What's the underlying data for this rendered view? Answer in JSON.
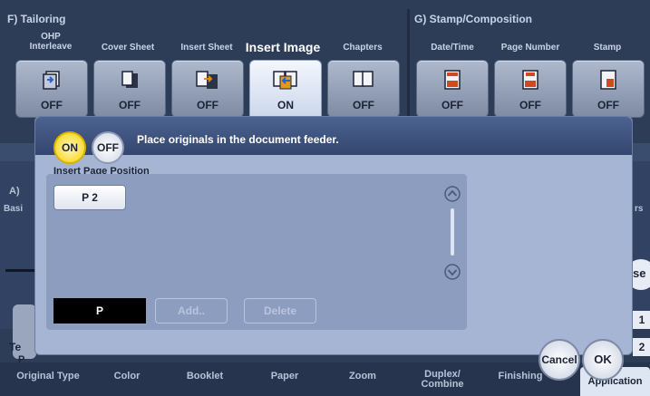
{
  "sections": {
    "tailoring": "F)  Tailoring",
    "stamp": "G)  Stamp/Composition"
  },
  "functions": [
    {
      "label": "OHP\nInterleave",
      "status": "OFF",
      "icon": "ohp-interleave-icon"
    },
    {
      "label": "Cover Sheet",
      "status": "OFF",
      "icon": "cover-sheet-icon"
    },
    {
      "label": "Insert Sheet",
      "status": "OFF",
      "icon": "insert-sheet-icon"
    },
    {
      "label": "Insert Image",
      "status": "ON",
      "icon": "insert-image-icon"
    },
    {
      "label": "Chapters",
      "status": "OFF",
      "icon": "chapters-icon"
    },
    {
      "label": "Date/Time",
      "status": "OFF",
      "icon": "date-time-icon"
    },
    {
      "label": "Page Number",
      "status": "OFF",
      "icon": "page-number-icon"
    },
    {
      "label": "Stamp",
      "status": "OFF",
      "icon": "stamp-icon"
    }
  ],
  "background": {
    "section_a": "A)",
    "basic": "Basi",
    "right_label": "rs",
    "right_button": "se",
    "num1": "1",
    "num2": "2",
    "text_left": "Te",
    "text_left2": "P"
  },
  "bottom_tabs": [
    "Original Type",
    "Color",
    "Booklet",
    "Paper",
    "Zoom",
    "Duplex/\nCombine",
    "Finishing",
    "Application"
  ],
  "dialog": {
    "on_label": "ON",
    "off_label": "OFF",
    "message": "Place originals in the document feeder.",
    "insert_page_position": "Insert Page Position",
    "page_items": [
      "P 2"
    ],
    "input_value": "P",
    "add_label": "Add..",
    "delete_label": "Delete",
    "cancel_label": "Cancel",
    "ok_label": "OK"
  },
  "colors": {
    "accent_on": "#f5d000",
    "dialog_bg": "#a6b5d3",
    "header_bg": "#33466f"
  }
}
